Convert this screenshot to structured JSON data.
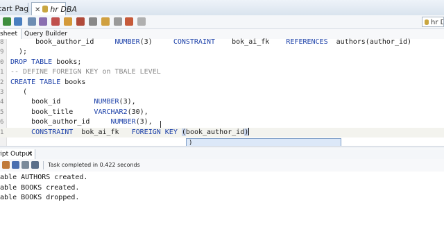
{
  "doc_tabs": {
    "start_page": "Start Page",
    "connection_tab": "hr DBA"
  },
  "toolbar": {
    "connection": "hr DBA",
    "icons": [
      "run-statement",
      "run-script",
      "commit",
      "rollback",
      "autotrace",
      "explain-plan",
      "sql-tuning",
      "clear",
      "format",
      "history",
      "unshared",
      "sql-history"
    ]
  },
  "editor_tabs": {
    "worksheet": "sheet",
    "query_builder": "Query Builder"
  },
  "editor": {
    "lines": [
      {
        "ln": "8",
        "tokens": [
          {
            "t": "      book_author_id     "
          },
          {
            "t": "NUMBER",
            "c": "kw"
          },
          {
            "t": "(3)     "
          },
          {
            "t": "CONSTRAINT",
            "c": "kw"
          },
          {
            "t": "    bok_ai_fk    "
          },
          {
            "t": "REFERENCES",
            "c": "kw"
          },
          {
            "t": "  authors(author_id)"
          }
        ]
      },
      {
        "ln": "9",
        "tokens": [
          {
            "t": "  );"
          }
        ]
      },
      {
        "ln": "0",
        "tokens": [
          {
            "t": "DROP TABLE",
            "c": "kw"
          },
          {
            "t": " books;"
          }
        ]
      },
      {
        "ln": "1",
        "tokens": [
          {
            "t": "-- DEFINE FOREIGN KEY on TBALE LEVEL",
            "c": "cm"
          }
        ]
      },
      {
        "ln": "2",
        "tokens": [
          {
            "t": "CREATE TABLE",
            "c": "kw"
          },
          {
            "t": " books"
          }
        ]
      },
      {
        "ln": "3",
        "tokens": [
          {
            "t": "   ("
          }
        ]
      },
      {
        "ln": "4",
        "tokens": [
          {
            "t": "     book_id        "
          },
          {
            "t": "NUMBER",
            "c": "kw"
          },
          {
            "t": "(3),"
          }
        ]
      },
      {
        "ln": "5",
        "tokens": [
          {
            "t": "     book_title     "
          },
          {
            "t": "VARCHAR2",
            "c": "kw"
          },
          {
            "t": "(30),"
          }
        ]
      },
      {
        "ln": "6",
        "tokens": [
          {
            "t": "     book_author_id     "
          },
          {
            "t": "NUMBER",
            "c": "kw"
          },
          {
            "t": "(3),"
          }
        ]
      },
      {
        "ln": "1",
        "current": true,
        "tokens": [
          {
            "t": "     "
          },
          {
            "t": "CONSTRAINT",
            "c": "kw"
          },
          {
            "t": "  bok_ai_fk   "
          },
          {
            "t": "FOREIGN KEY",
            "c": "kw"
          },
          {
            "t": " "
          },
          {
            "t": "(",
            "c": "hl"
          },
          {
            "t": "book_author_id"
          },
          {
            "t": ")",
            "c": "hl"
          },
          {
            "caret": true
          }
        ]
      }
    ],
    "autocomplete": [
      ")",
      ","
    ]
  },
  "output_panel": {
    "tab_label": "Script Output",
    "status": "Task completed in 0.422 seconds",
    "lines": [
      "table AUTHORS created.",
      "table BOOKS created.",
      "table BOOKS dropped."
    ]
  },
  "colors": {
    "keyword": "#1a3fa8",
    "comment": "#8a8a8a",
    "bracket_highlight": "#c9d6ec",
    "autocomplete_bg": "#dce8f8"
  }
}
